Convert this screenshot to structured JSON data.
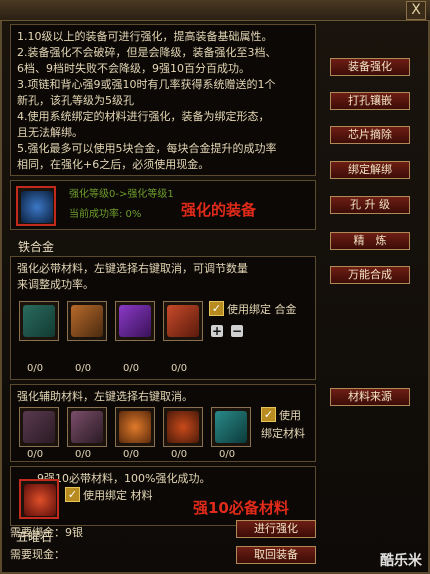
{
  "window": {
    "close_label": "X"
  },
  "info": {
    "lines": [
      "1.10级以上的装备可进行强化，提高装备基础属性。",
      "2.装备强化不会破碎，但是会降级，装备强化至3档、",
      "6档、9档时失败不会降级，9强10百分百成功。",
      "3.项链和背心强9或强10时有几率获得系统赠送的1个",
      "新孔，该孔等级为5级孔",
      "4.使用系统绑定的材料进行强化，装备为绑定形态，",
      "且无法解绑。",
      "5.强化最多可以使用5块合金，每块合金提升的成功率",
      "相同，在强化+6之后，必须使用现金。"
    ]
  },
  "equip": {
    "level_text": "强化等级0->强化等级1",
    "rate_text": "当前成功率: 0%",
    "annotation": "强化的装备"
  },
  "item_name": "铁合金",
  "material": {
    "desc_line1": "强化必带材料，左键选择右键取消，可调节数量",
    "desc_line2": "来调整成功率。",
    "counts": [
      "0/0",
      "0/0",
      "0/0",
      "0/0"
    ],
    "checkbox_label": "使用绑定 合金",
    "plus": "+",
    "minus": "−"
  },
  "aux": {
    "desc": "强化辅助材料，左键选择右键取消。",
    "counts": [
      "0/0",
      "0/0",
      "0/0",
      "0/0",
      "0/0"
    ],
    "checkbox_label1": "使用",
    "checkbox_label2": "绑定材料"
  },
  "strong": {
    "desc": "9强10必带材料，100%强化成功。",
    "checkbox_label": "使用绑定 材料",
    "annotation": "强10必备材料",
    "item_name": "五曜石"
  },
  "costs": {
    "bind_gold": "需要绑金：9银",
    "cash": "需要现金："
  },
  "actions": {
    "start": "进行强化",
    "take_back": "取回装备"
  },
  "right_menu": [
    "装备强化",
    "打孔镶嵌",
    "芯片摘除",
    "绑定解绑",
    "孔 升 级",
    "精　炼",
    "万能合成"
  ],
  "material_source": "材料来源",
  "watermark": "酷乐米",
  "checkmark": "✓"
}
